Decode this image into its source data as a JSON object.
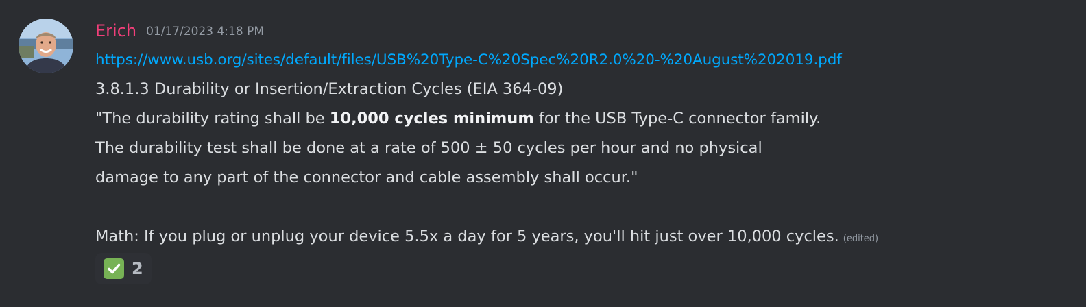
{
  "message": {
    "author": "Erich",
    "timestamp": "01/17/2023 4:18 PM",
    "link": "https://www.usb.org/sites/default/files/USB%20Type-C%20Spec%20R2.0%20-%20August%202019.pdf",
    "line_section": "3.8.1.3 Durability or Insertion/Extraction Cycles (EIA 364-09)",
    "quote_line1_before": "\"The durability rating shall be ",
    "quote_line1_bold": "10,000 cycles minimum",
    "quote_line1_after": " for the USB Type-C connector family.",
    "quote_line2": "The durability test shall be done at a rate of 500 ± 50 cycles per hour and no physical",
    "quote_line3": "damage to any part of the connector and cable assembly shall occur.\"",
    "math_line": "Math: If you plug or unplug your device 5.5x a day for 5 years, you'll hit just over 10,000 cycles.",
    "edited_label": "(edited)"
  },
  "reactions": [
    {
      "emoji": "white-check-mark-icon",
      "count": "2"
    }
  ],
  "colors": {
    "background": "#2b2d31",
    "username": "#f23f7a",
    "link": "#00a8fc",
    "text": "#dbdee1",
    "muted": "#949ba4",
    "reaction_bg": "#2e3035",
    "check_green": "#77b255"
  }
}
